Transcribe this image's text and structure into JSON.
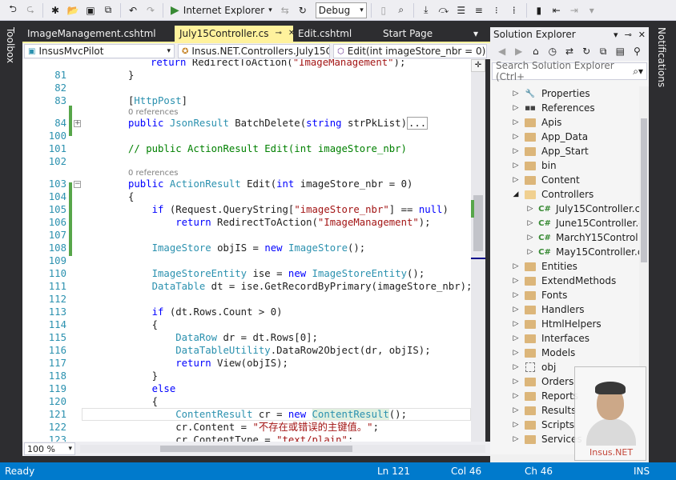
{
  "toolbar": {
    "run_label": "Internet Explorer",
    "config": "Debug"
  },
  "side_tabs": {
    "left": "Toolbox",
    "right": "Notifications"
  },
  "doc_tabs": [
    {
      "label": "ImageManagement.cshtml"
    },
    {
      "label": "July15Controller.cs"
    },
    {
      "label": "Edit.cshtml"
    },
    {
      "label": "Start Page"
    }
  ],
  "nav": {
    "project": "InsusMvcPilot",
    "class": "Insus.NET.Controllers.July15C",
    "member": "Edit(int imageStore_nbr = 0)"
  },
  "editor": {
    "zoom": "100 %",
    "lines": [
      {
        "n": "",
        "text": "    return RedirectToAction(\"ImageManagement\");"
      },
      {
        "n": "81",
        "text": "}"
      },
      {
        "n": "82",
        "text": ""
      },
      {
        "n": "83",
        "text": "[HttpPost]"
      },
      {
        "n": "",
        "text": "0 references"
      },
      {
        "n": "84",
        "text": "public JsonResult BatchDelete(string strPkList)"
      },
      {
        "n": "100",
        "text": ""
      },
      {
        "n": "101",
        "text": "// public ActionResult Edit(int imageStore_nbr)"
      },
      {
        "n": "102",
        "text": ""
      },
      {
        "n": "",
        "text": "0 references"
      },
      {
        "n": "103",
        "text": "public ActionResult Edit(int imageStore_nbr = 0)"
      },
      {
        "n": "104",
        "text": "{"
      },
      {
        "n": "105",
        "text": "    if (Request.QueryString[\"imageStore_nbr\"] == null)"
      },
      {
        "n": "106",
        "text": "        return RedirectToAction(\"ImageManagement\");"
      },
      {
        "n": "107",
        "text": ""
      },
      {
        "n": "108",
        "text": "    ImageStore objIS = new ImageStore();"
      },
      {
        "n": "109",
        "text": ""
      },
      {
        "n": "110",
        "text": "    ImageStoreEntity ise = new ImageStoreEntity();"
      },
      {
        "n": "111",
        "text": "    DataTable dt = ise.GetRecordByPrimary(imageStore_nbr);"
      },
      {
        "n": "112",
        "text": ""
      },
      {
        "n": "113",
        "text": "    if (dt.Rows.Count > 0)"
      },
      {
        "n": "114",
        "text": "    {"
      },
      {
        "n": "115",
        "text": "        DataRow dr = dt.Rows[0];"
      },
      {
        "n": "116",
        "text": "        DataTableUtility.DataRow2Object(dr, objIS);"
      },
      {
        "n": "117",
        "text": "        return View(objIS);"
      },
      {
        "n": "118",
        "text": "    }"
      },
      {
        "n": "119",
        "text": "    else"
      },
      {
        "n": "120",
        "text": "    {"
      },
      {
        "n": "121",
        "text": "        ContentResult cr = new ContentResult();"
      },
      {
        "n": "122",
        "text": "        cr.Content = \"不存在或错误的主键值。\";"
      },
      {
        "n": "123",
        "text": "        cr.ContentType = \"text/plain\";"
      }
    ]
  },
  "solution_explorer": {
    "title": "Solution Explorer",
    "search_placeholder": "Search Solution Explorer (Ctrl+",
    "items": [
      {
        "label": "Properties",
        "icon": "wrench-icon"
      },
      {
        "label": "References",
        "icon": "references-icon"
      },
      {
        "label": "Apis",
        "icon": "folder-icon"
      },
      {
        "label": "App_Data",
        "icon": "folder-icon"
      },
      {
        "label": "App_Start",
        "icon": "folder-icon"
      },
      {
        "label": "bin",
        "icon": "folder-icon"
      },
      {
        "label": "Content",
        "icon": "folder-icon"
      },
      {
        "label": "Controllers",
        "icon": "folder-open-icon"
      },
      {
        "label": "July15Controller.c",
        "icon": "csharp-file-icon"
      },
      {
        "label": "June15Controller.c",
        "icon": "csharp-file-icon"
      },
      {
        "label": "MarchY15Control",
        "icon": "csharp-file-icon"
      },
      {
        "label": "May15Controller.c",
        "icon": "csharp-file-icon"
      },
      {
        "label": "Entities",
        "icon": "folder-icon"
      },
      {
        "label": "ExtendMethods",
        "icon": "folder-icon"
      },
      {
        "label": "Fonts",
        "icon": "folder-icon"
      },
      {
        "label": "Handlers",
        "icon": "folder-icon"
      },
      {
        "label": "HtmlHelpers",
        "icon": "folder-icon"
      },
      {
        "label": "Interfaces",
        "icon": "folder-icon"
      },
      {
        "label": "Models",
        "icon": "folder-icon"
      },
      {
        "label": "obj",
        "icon": "hidden-folder-icon"
      },
      {
        "label": "Orders",
        "icon": "folder-icon"
      },
      {
        "label": "Reports",
        "icon": "folder-icon"
      },
      {
        "label": "Results",
        "icon": "folder-icon"
      },
      {
        "label": "Scripts",
        "icon": "folder-icon"
      },
      {
        "label": "Services",
        "icon": "folder-icon"
      }
    ]
  },
  "webcam": {
    "label": "Insus.NET"
  },
  "status": {
    "ready": "Ready",
    "line": "Ln 121",
    "col": "Col 46",
    "ch": "Ch 46",
    "mode": "INS"
  },
  "colors": {
    "accent": "#007acc",
    "active_tab": "#fff29d",
    "change_mark": "#57a64a"
  }
}
